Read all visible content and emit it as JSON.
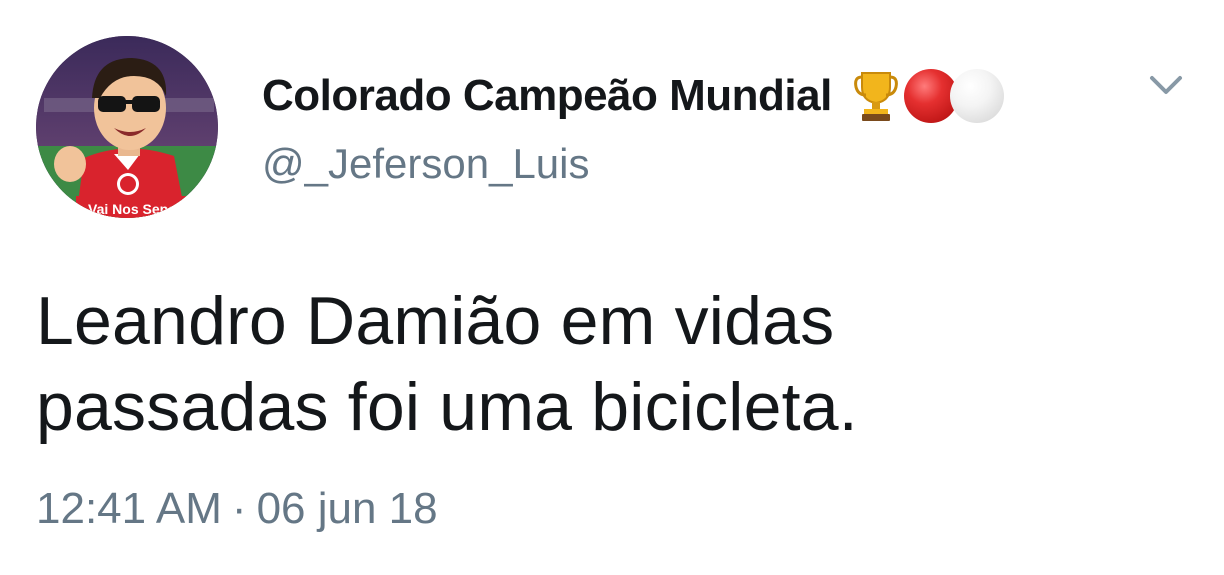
{
  "user": {
    "display_name": "Colorado Campeão Mundial",
    "handle": "@_Jeferson_Luis",
    "avatar_caption": "Vai Nos Sepa",
    "name_emojis": [
      "trophy-icon",
      "red-circle-icon",
      "white-circle-icon"
    ]
  },
  "tweet": {
    "text_lines": [
      "Leandro Damião em vidas",
      "passadas foi uma bicicleta."
    ],
    "time": "12:41 AM",
    "separator": "·",
    "date": "06 jun 18"
  },
  "menu": {
    "icon": "chevron-down-icon"
  },
  "colors": {
    "text_primary": "#14171a",
    "text_secondary": "#657786",
    "emoji_red": "#e53030",
    "avatar_shirt": "#d9232d"
  }
}
